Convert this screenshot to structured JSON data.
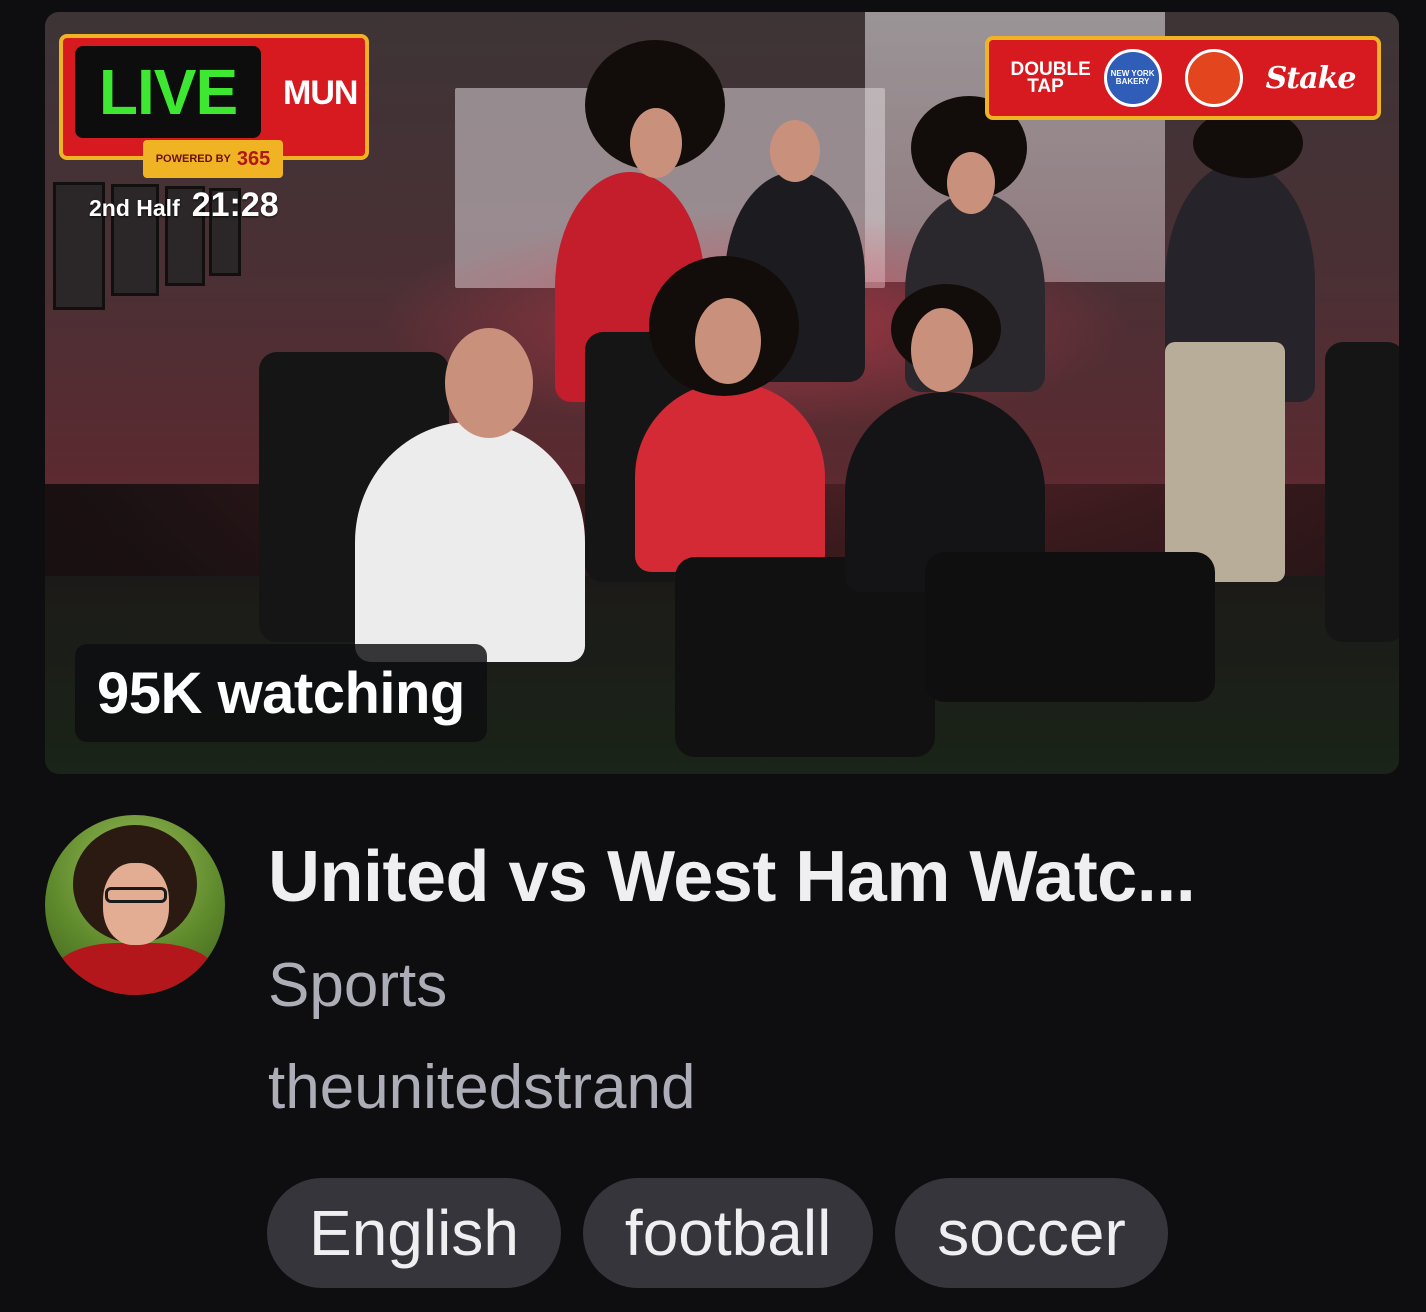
{
  "stream": {
    "overlay": {
      "live_label": "LIVE",
      "team": "MUN",
      "powered_by": "POWERED BY",
      "powered_brand": "365",
      "half": "2nd Half",
      "clock": "21:28",
      "sponsors": {
        "double_tap": "DOUBLE TAP",
        "bakery": "NEW YORK BAKERY",
        "stake": "Stake"
      },
      "colors": {
        "accent_red": "#d71920",
        "accent_gold": "#f0b323",
        "live_green": "#3ee832"
      }
    },
    "viewers": "95K watching",
    "title": "United vs West Ham Watc...",
    "category": "Sports",
    "channel": "theunitedstrand",
    "avatar_icon": "channel-avatar",
    "tags": [
      "English",
      "football",
      "soccer"
    ]
  }
}
